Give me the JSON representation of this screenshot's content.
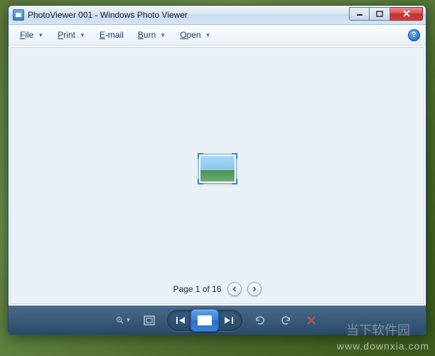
{
  "window": {
    "title": "PhotoViewer 001 - Windows Photo Viewer"
  },
  "menu": {
    "file": "File",
    "print": "Print",
    "email": "E-mail",
    "burn": "Burn",
    "open": "Open"
  },
  "pager": {
    "label": "Page 1 of 16"
  },
  "watermark": {
    "url": "www.downxia.com",
    "cn": "当下软件园"
  }
}
